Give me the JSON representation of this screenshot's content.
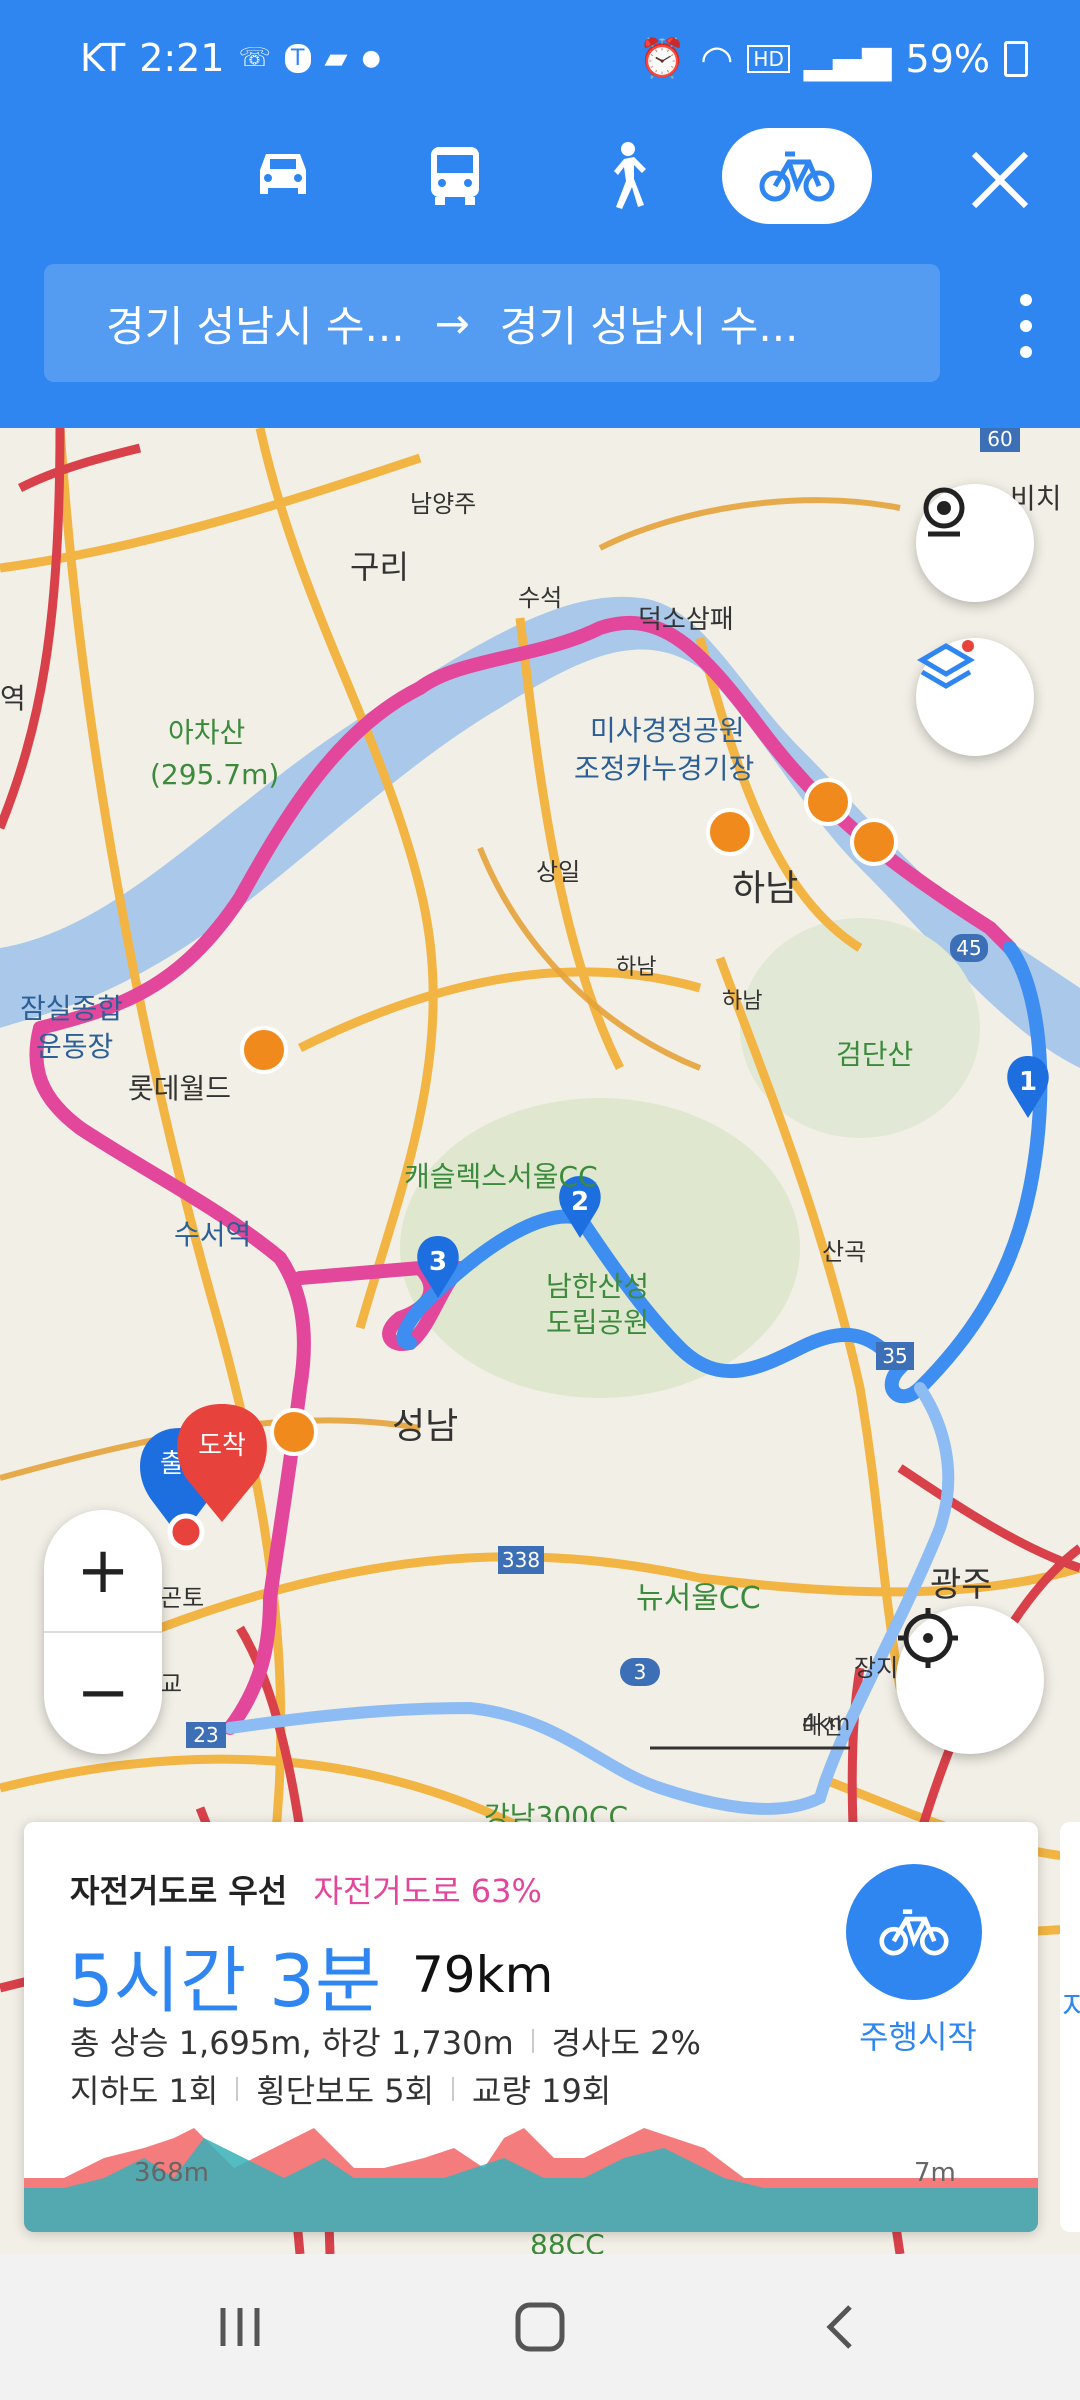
{
  "status": {
    "carrier": "KT",
    "time": "2:21",
    "battery": "59%"
  },
  "modes": [
    {
      "name": "car",
      "active": false
    },
    {
      "name": "bus",
      "active": false
    },
    {
      "name": "walk",
      "active": false
    },
    {
      "name": "bike",
      "active": true
    }
  ],
  "route": {
    "from": "경기 성남시 수...",
    "arrow": "→",
    "to": "경기 성남시 수..."
  },
  "map_labels": {
    "guri": "구리",
    "namyangju": "남양주",
    "suseok": "수석",
    "deokso": "덕소삼패",
    "achasan": "아차산",
    "achasan_h": "(295.7m)",
    "misa1": "미사경정공원",
    "misa2": "조정카누경기장",
    "sangil": "상일",
    "hanam": "하남",
    "hanam_jc": "하남",
    "hanam_ic": "하남",
    "jamsil1": "잠실종합",
    "jamsil2": "운동장",
    "lotte": "롯데월드",
    "geomdan": "검단산",
    "castle": "캐슬렉스서울CC",
    "suseo": "수서역",
    "namhan1": "남한산성",
    "namhan2": "도립공원",
    "sangok": "산곡",
    "seongnam": "성남",
    "newseoul": "뉴서울CC",
    "gwangju": "광주",
    "jangji": "장지",
    "gangnam300": "강남300CC",
    "cc88": "88CC",
    "yeok": "역",
    "gon": "곤토",
    "gyo": "교",
    "arrive": "도착",
    "depart": "출",
    "route_label": "비치",
    "wp1": "1",
    "wp2": "2",
    "wp3": "3",
    "sh_338": "338",
    "sh_45": "45",
    "sh_35": "35",
    "sh_3": "3",
    "sh_60": "60",
    "sh_23": "23",
    "scale": "4km",
    "daesin": "대신"
  },
  "summary": {
    "type": "자전거도로 우선",
    "ratio": "자전거도로 63%",
    "time": "5시간 3분",
    "distance": "79km",
    "climb": "총 상승 1,695m, 하강 1,730m",
    "slope": "경사도 2%",
    "underpass": "지하도 1회",
    "crosswalk": "횡단보도 5회",
    "bridge": "교량 19회",
    "start_label": "주행시작",
    "elev_max": "368m",
    "elev_min": "7m",
    "side_peek": "지"
  },
  "colors": {
    "primary": "#2f86f0",
    "bike_route": "#e2479c",
    "route_blue": "#3d8ef0"
  }
}
